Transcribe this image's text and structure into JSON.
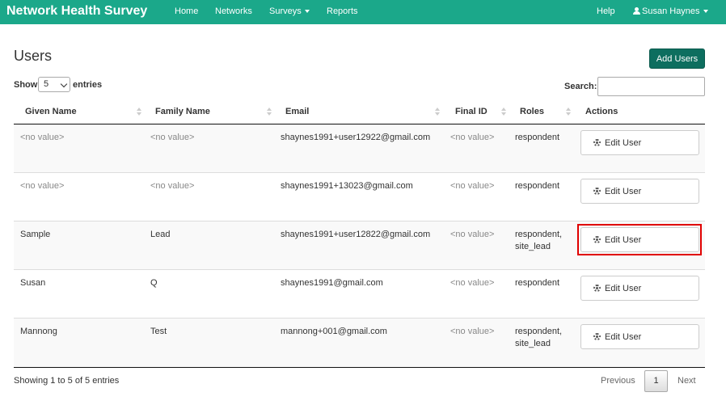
{
  "navbar": {
    "brand": "Network Health Survey",
    "items": [
      {
        "label": "Home"
      },
      {
        "label": "Networks"
      },
      {
        "label": "Surveys"
      },
      {
        "label": "Reports"
      }
    ],
    "help": "Help",
    "user": "Susan Haynes"
  },
  "page": {
    "title": "Users",
    "add_button": "Add Users"
  },
  "controls": {
    "show_label": "Show",
    "entries_label": "entries",
    "length_value": "5",
    "search_label": "Search:",
    "search_value": ""
  },
  "table": {
    "columns": [
      "Given Name",
      "Family Name",
      "Email",
      "Final ID",
      "Roles",
      "Actions"
    ],
    "action_label": "Edit User",
    "rows": [
      {
        "given": "<no value>",
        "family": "<no value>",
        "email": "shaynes1991+user12922@gmail.com",
        "final_id": "<no value>",
        "roles": [
          "respondent"
        ]
      },
      {
        "given": "<no value>",
        "family": "<no value>",
        "email": "shaynes1991+13023@gmail.com",
        "final_id": "<no value>",
        "roles": [
          "respondent"
        ]
      },
      {
        "given": "Sample",
        "family": "Lead",
        "email": "shaynes1991+user12822@gmail.com",
        "final_id": "<no value>",
        "roles": [
          "respondent,",
          "site_lead"
        ]
      },
      {
        "given": "Susan",
        "family": "Q",
        "email": "shaynes1991@gmail.com",
        "final_id": "<no value>",
        "roles": [
          "respondent"
        ]
      },
      {
        "given": "Mannong",
        "family": "Test",
        "email": "mannong+001@gmail.com",
        "final_id": "<no value>",
        "roles": [
          "respondent,",
          "site_lead"
        ]
      }
    ]
  },
  "footer": {
    "info": "Showing 1 to 5 of 5 entries",
    "previous": "Previous",
    "current_page": "1",
    "next": "Next"
  }
}
